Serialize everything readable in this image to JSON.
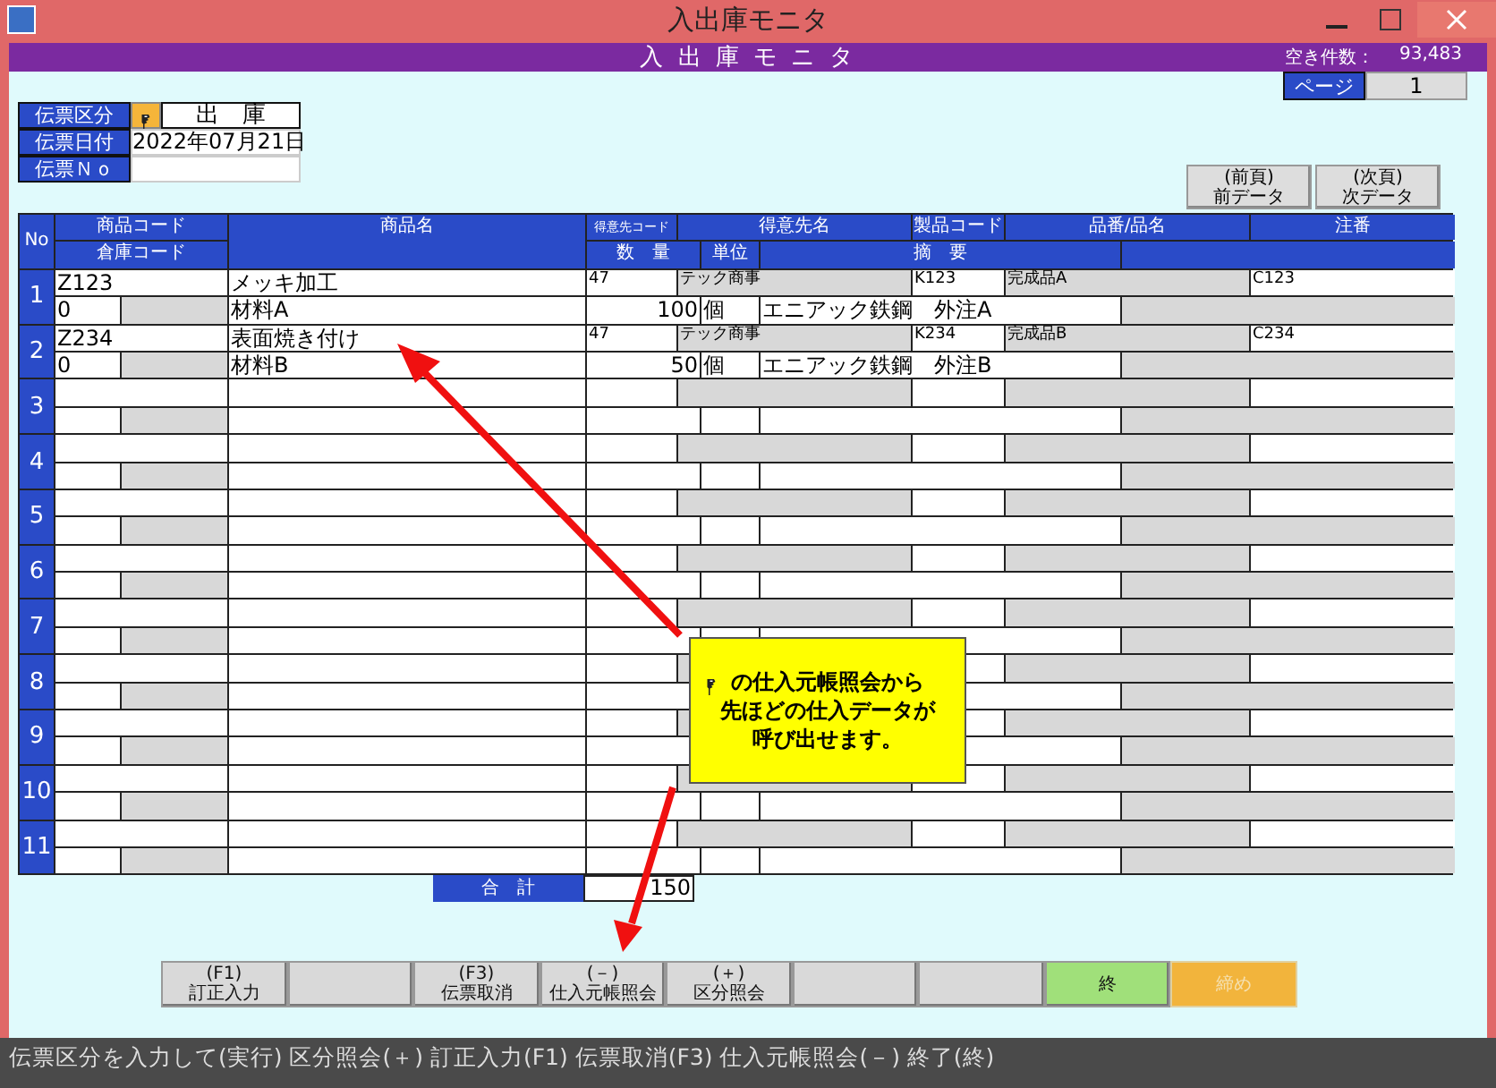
{
  "window": {
    "title": "入出庫モニタ"
  },
  "header_bar": {
    "title": "入 出 庫 モ ニ タ",
    "free_count_label": "空き件数：",
    "free_count": "93,483"
  },
  "page": {
    "label": "ページ",
    "value": "1"
  },
  "slip_fields": [
    {
      "label": "伝票区分",
      "value": "出　庫",
      "kind": "lookup"
    },
    {
      "label": "伝票日付",
      "value": "2022年07月21日",
      "kind": "text"
    },
    {
      "label": "伝票Ｎｏ",
      "kind": "text"
    }
  ],
  "nav_buttons": [
    {
      "key": "(前頁)",
      "label": "前データ"
    },
    {
      "key": "(次頁)",
      "label": "次データ"
    }
  ],
  "table": {
    "header_top": [
      "No",
      "商品コード",
      "商品名",
      "得意先コード",
      "得意先名",
      "製品コード",
      "品番/品名",
      "注番"
    ],
    "header_bottom": [
      "倉庫コード",
      "数　量",
      "単位",
      "摘　要"
    ],
    "rows": [
      {
        "no": "1",
        "product_code": "Z123",
        "product_name": "メッキ加工",
        "customer_code": "47",
        "customer_name": "テック商事",
        "item_code": "K123",
        "item_name": "完成品A",
        "order_no": "C123",
        "warehouse_code": "0",
        "material": "材料A",
        "quantity": "100",
        "unit": "個",
        "summary": "エニアック鉄鋼　外注A"
      },
      {
        "no": "2",
        "product_code": "Z234",
        "product_name": "表面焼き付け",
        "customer_code": "47",
        "customer_name": "テック商事",
        "item_code": "K234",
        "item_name": "完成品B",
        "order_no": "C234",
        "warehouse_code": "0",
        "material": "材料B",
        "quantity": "50",
        "unit": "個",
        "summary": "エニアック鉄鋼　外注B"
      },
      {
        "no": "3"
      },
      {
        "no": "4"
      },
      {
        "no": "5"
      },
      {
        "no": "6"
      },
      {
        "no": "7"
      },
      {
        "no": "8"
      },
      {
        "no": "9"
      },
      {
        "no": "10"
      },
      {
        "no": "11"
      }
    ]
  },
  "total": {
    "label": "合　計",
    "value": "150"
  },
  "function_keys": [
    {
      "key": "(F1)",
      "label": "訂正入力",
      "kind": "normal",
      "disabled": false
    },
    {
      "kind": "blank",
      "disabled": false
    },
    {
      "key": "(F3)",
      "label": "伝票取消",
      "kind": "normal",
      "disabled": false
    },
    {
      "key": "(－)",
      "label": "仕入元帳照会",
      "kind": "normal",
      "disabled": false
    },
    {
      "key": "(＋)",
      "label": "区分照会",
      "kind": "normal",
      "disabled": false
    },
    {
      "kind": "blank",
      "disabled": false
    },
    {
      "kind": "blank",
      "disabled": false
    },
    {
      "label": "終",
      "kind": "exit",
      "disabled": false
    },
    {
      "label": "締め",
      "kind": "close",
      "disabled": true
    }
  ],
  "callout": {
    "lines": [
      "の仕入元帳照会から",
      "先ほどの仕入データが",
      "呼び出せます。"
    ]
  },
  "status_bar": "伝票区分を入力して(実行) 区分照会(＋) 訂正入力(F1) 伝票取消(F3) 仕入元帳照会(－) 終了(終)"
}
